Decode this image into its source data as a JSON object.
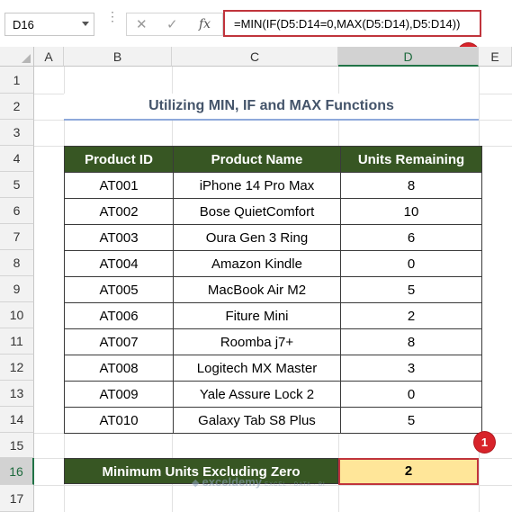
{
  "formula_bar": {
    "name_box": "D16",
    "cancel_icon": "close-icon",
    "enter_icon": "check-icon",
    "fx_label": "fx",
    "formula": "=MIN(IF(D5:D14=0,MAX(D5:D14),D5:D14))"
  },
  "columns": [
    "A",
    "B",
    "C",
    "D",
    "E"
  ],
  "rows": [
    "1",
    "2",
    "3",
    "4",
    "5",
    "6",
    "7",
    "8",
    "9",
    "10",
    "11",
    "12",
    "13",
    "14",
    "15",
    "16",
    "17"
  ],
  "title": "Utilizing MIN, IF and MAX Functions",
  "table": {
    "headers": [
      "Product ID",
      "Product Name",
      "Units Remaining"
    ],
    "rows": [
      [
        "AT001",
        "iPhone 14 Pro Max",
        "8"
      ],
      [
        "AT002",
        "Bose QuietComfort",
        "10"
      ],
      [
        "AT003",
        "Oura Gen 3 Ring",
        "6"
      ],
      [
        "AT004",
        "Amazon Kindle",
        "0"
      ],
      [
        "AT005",
        "MacBook Air M2",
        "5"
      ],
      [
        "AT006",
        "Fiture Mini",
        "2"
      ],
      [
        "AT007",
        "Roomba j7+",
        "8"
      ],
      [
        "AT008",
        "Logitech MX Master",
        "3"
      ],
      [
        "AT009",
        "Yale Assure Lock 2",
        "0"
      ],
      [
        "AT010",
        "Galaxy Tab S8 Plus",
        "5"
      ]
    ]
  },
  "summary": {
    "label": "Minimum Units Excluding Zero",
    "value": "2"
  },
  "badges": [
    "1",
    "2"
  ],
  "watermark": {
    "name": "exceldemy",
    "tagline": "EXCEL · DATA · BI"
  },
  "colors": {
    "header_green": "#375623",
    "highlight_yellow": "#ffe699",
    "badge_red": "#d8232a",
    "title_text": "#44546a"
  }
}
